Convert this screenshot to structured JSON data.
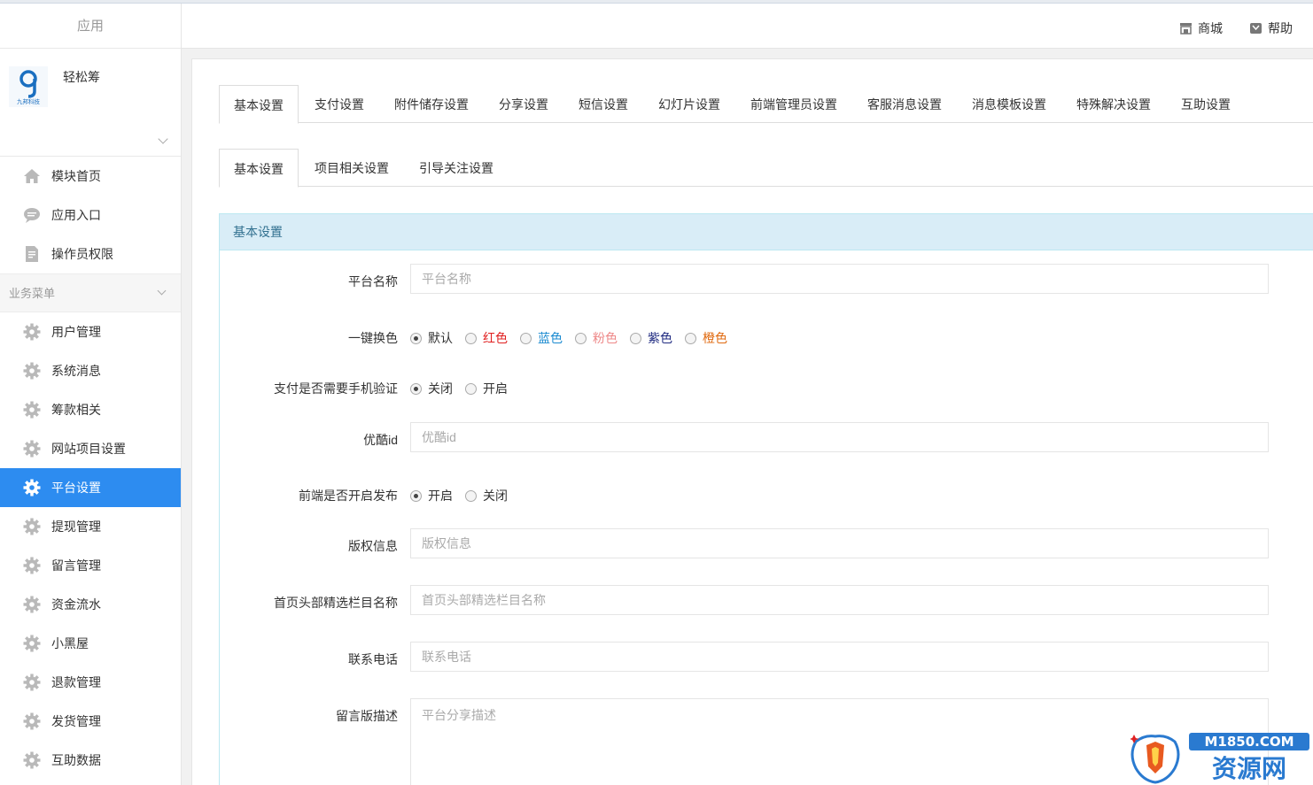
{
  "sidebar": {
    "header": "应用",
    "app_name": "轻松筹",
    "logo_text": "九邦科技",
    "top_items": [
      {
        "label": "模块首页",
        "icon": "home-icon"
      },
      {
        "label": "应用入口",
        "icon": "chat-icon"
      },
      {
        "label": "操作员权限",
        "icon": "document-icon"
      }
    ],
    "group_label": "业务菜单",
    "menu_items": [
      {
        "label": "用户管理",
        "icon": "gear-icon"
      },
      {
        "label": "系统消息",
        "icon": "gear-icon"
      },
      {
        "label": "筹款相关",
        "icon": "gear-icon"
      },
      {
        "label": "网站项目设置",
        "icon": "gear-icon"
      },
      {
        "label": "平台设置",
        "icon": "gear-icon",
        "active": true
      },
      {
        "label": "提现管理",
        "icon": "gear-icon"
      },
      {
        "label": "留言管理",
        "icon": "gear-icon"
      },
      {
        "label": "资金流水",
        "icon": "gear-icon"
      },
      {
        "label": "小黑屋",
        "icon": "gear-icon"
      },
      {
        "label": "退款管理",
        "icon": "gear-icon"
      },
      {
        "label": "发货管理",
        "icon": "gear-icon"
      },
      {
        "label": "互助数据",
        "icon": "gear-icon"
      }
    ]
  },
  "header": {
    "shop_label": "商城",
    "help_label": "帮助"
  },
  "main_tabs": [
    "基本设置",
    "支付设置",
    "附件储存设置",
    "分享设置",
    "短信设置",
    "幻灯片设置",
    "前端管理员设置",
    "客服消息设置",
    "消息模板设置",
    "特殊解决设置",
    "互助设置"
  ],
  "main_tab_active": "基本设置",
  "sub_tabs": [
    "基本设置",
    "项目相关设置",
    "引导关注设置"
  ],
  "sub_tab_active": "基本设置",
  "form": {
    "section_title": "基本设置",
    "platform_name": {
      "label": "平台名称",
      "placeholder": "平台名称"
    },
    "theme": {
      "label": "一键换色",
      "options": [
        {
          "label": "默认",
          "color": "#333333",
          "checked": true
        },
        {
          "label": "红色",
          "color": "#e02020"
        },
        {
          "label": "蓝色",
          "color": "#1a8ad0"
        },
        {
          "label": "粉色",
          "color": "#ee8888"
        },
        {
          "label": "紫色",
          "color": "#1f2a80"
        },
        {
          "label": "橙色",
          "color": "#e06a10"
        }
      ]
    },
    "phone_verify": {
      "label": "支付是否需要手机验证",
      "options": [
        {
          "label": "关闭",
          "checked": true
        },
        {
          "label": "开启"
        }
      ]
    },
    "youku_id": {
      "label": "优酷id",
      "placeholder": "优酷id"
    },
    "frontend_publish": {
      "label": "前端是否开启发布",
      "options": [
        {
          "label": "开启",
          "checked": true
        },
        {
          "label": "关闭"
        }
      ]
    },
    "copyright": {
      "label": "版权信息",
      "placeholder": "版权信息"
    },
    "home_column": {
      "label": "首页头部精选栏目名称",
      "placeholder": "首页头部精选栏目名称"
    },
    "contact_phone": {
      "label": "联系电话",
      "placeholder": "联系电话"
    },
    "message_desc": {
      "label": "留言版描述",
      "placeholder": "平台分享描述"
    }
  },
  "watermark": {
    "domain": "M1850.COM",
    "name": "资源网"
  }
}
